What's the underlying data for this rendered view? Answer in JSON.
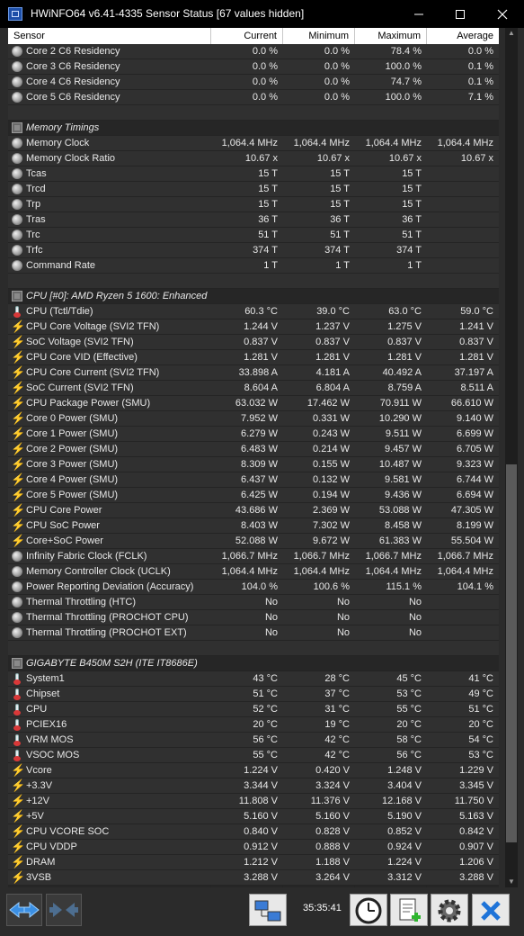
{
  "window": {
    "title": "HWiNFO64 v6.41-4335 Sensor Status [67 values hidden]"
  },
  "columns": [
    "Sensor",
    "Current",
    "Minimum",
    "Maximum",
    "Average"
  ],
  "rows": [
    {
      "type": "sensor",
      "icon": "gear-icon",
      "name": "Core 2 C6 Residency",
      "v": [
        "0.0 %",
        "0.0 %",
        "78.4 %",
        "0.0 %"
      ]
    },
    {
      "type": "sensor",
      "icon": "gear-icon",
      "name": "Core 3 C6 Residency",
      "v": [
        "0.0 %",
        "0.0 %",
        "100.0 %",
        "0.1 %"
      ]
    },
    {
      "type": "sensor",
      "icon": "gear-icon",
      "name": "Core 4 C6 Residency",
      "v": [
        "0.0 %",
        "0.0 %",
        "74.7 %",
        "0.1 %"
      ]
    },
    {
      "type": "sensor",
      "icon": "gear-icon",
      "name": "Core 5 C6 Residency",
      "v": [
        "0.0 %",
        "0.0 %",
        "100.0 %",
        "7.1 %"
      ]
    },
    {
      "type": "blank"
    },
    {
      "type": "group",
      "icon": "chip-icon",
      "name": "Memory Timings"
    },
    {
      "type": "sensor",
      "icon": "gear-icon",
      "name": "Memory Clock",
      "v": [
        "1,064.4 MHz",
        "1,064.4 MHz",
        "1,064.4 MHz",
        "1,064.4 MHz"
      ]
    },
    {
      "type": "sensor",
      "icon": "gear-icon",
      "name": "Memory Clock Ratio",
      "v": [
        "10.67 x",
        "10.67 x",
        "10.67 x",
        "10.67 x"
      ]
    },
    {
      "type": "sensor",
      "icon": "gear-icon",
      "name": "Tcas",
      "v": [
        "15 T",
        "15 T",
        "15 T",
        ""
      ]
    },
    {
      "type": "sensor",
      "icon": "gear-icon",
      "name": "Trcd",
      "v": [
        "15 T",
        "15 T",
        "15 T",
        ""
      ]
    },
    {
      "type": "sensor",
      "icon": "gear-icon",
      "name": "Trp",
      "v": [
        "15 T",
        "15 T",
        "15 T",
        ""
      ]
    },
    {
      "type": "sensor",
      "icon": "gear-icon",
      "name": "Tras",
      "v": [
        "36 T",
        "36 T",
        "36 T",
        ""
      ]
    },
    {
      "type": "sensor",
      "icon": "gear-icon",
      "name": "Trc",
      "v": [
        "51 T",
        "51 T",
        "51 T",
        ""
      ]
    },
    {
      "type": "sensor",
      "icon": "gear-icon",
      "name": "Trfc",
      "v": [
        "374 T",
        "374 T",
        "374 T",
        ""
      ]
    },
    {
      "type": "sensor",
      "icon": "gear-icon",
      "name": "Command Rate",
      "v": [
        "1 T",
        "1 T",
        "1 T",
        ""
      ]
    },
    {
      "type": "blank"
    },
    {
      "type": "group",
      "icon": "chip-icon",
      "name": "CPU [#0]: AMD Ryzen 5 1600: Enhanced"
    },
    {
      "type": "sensor",
      "icon": "thermometer-icon",
      "name": "CPU (Tctl/Tdie)",
      "v": [
        "60.3 °C",
        "39.0 °C",
        "63.0 °C",
        "59.0 °C"
      ]
    },
    {
      "type": "sensor",
      "icon": "bolt-icon",
      "name": "CPU Core Voltage (SVI2 TFN)",
      "v": [
        "1.244 V",
        "1.237 V",
        "1.275 V",
        "1.241 V"
      ]
    },
    {
      "type": "sensor",
      "icon": "bolt-icon",
      "name": "SoC Voltage (SVI2 TFN)",
      "v": [
        "0.837 V",
        "0.837 V",
        "0.837 V",
        "0.837 V"
      ]
    },
    {
      "type": "sensor",
      "icon": "bolt-icon",
      "name": "CPU Core VID (Effective)",
      "v": [
        "1.281 V",
        "1.281 V",
        "1.281 V",
        "1.281 V"
      ]
    },
    {
      "type": "sensor",
      "icon": "bolt-icon",
      "name": "CPU Core Current (SVI2 TFN)",
      "v": [
        "33.898 A",
        "4.181 A",
        "40.492 A",
        "37.197 A"
      ]
    },
    {
      "type": "sensor",
      "icon": "bolt-icon",
      "name": "SoC Current (SVI2 TFN)",
      "v": [
        "8.604 A",
        "6.804 A",
        "8.759 A",
        "8.511 A"
      ]
    },
    {
      "type": "sensor",
      "icon": "bolt-icon",
      "name": "CPU Package Power (SMU)",
      "v": [
        "63.032 W",
        "17.462 W",
        "70.911 W",
        "66.610 W"
      ]
    },
    {
      "type": "sensor",
      "icon": "bolt-icon",
      "name": "Core 0 Power (SMU)",
      "v": [
        "7.952 W",
        "0.331 W",
        "10.290 W",
        "9.140 W"
      ]
    },
    {
      "type": "sensor",
      "icon": "bolt-icon",
      "name": "Core 1 Power (SMU)",
      "v": [
        "6.279 W",
        "0.243 W",
        "9.511 W",
        "6.699 W"
      ]
    },
    {
      "type": "sensor",
      "icon": "bolt-icon",
      "name": "Core 2 Power (SMU)",
      "v": [
        "6.483 W",
        "0.214 W",
        "9.457 W",
        "6.705 W"
      ]
    },
    {
      "type": "sensor",
      "icon": "bolt-icon",
      "name": "Core 3 Power (SMU)",
      "v": [
        "8.309 W",
        "0.155 W",
        "10.487 W",
        "9.323 W"
      ]
    },
    {
      "type": "sensor",
      "icon": "bolt-icon",
      "name": "Core 4 Power (SMU)",
      "v": [
        "6.437 W",
        "0.132 W",
        "9.581 W",
        "6.744 W"
      ]
    },
    {
      "type": "sensor",
      "icon": "bolt-icon",
      "name": "Core 5 Power (SMU)",
      "v": [
        "6.425 W",
        "0.194 W",
        "9.436 W",
        "6.694 W"
      ]
    },
    {
      "type": "sensor",
      "icon": "bolt-icon",
      "name": "CPU Core Power",
      "v": [
        "43.686 W",
        "2.369 W",
        "53.088 W",
        "47.305 W"
      ]
    },
    {
      "type": "sensor",
      "icon": "bolt-icon",
      "name": "CPU SoC Power",
      "v": [
        "8.403 W",
        "7.302 W",
        "8.458 W",
        "8.199 W"
      ]
    },
    {
      "type": "sensor",
      "icon": "bolt-icon",
      "name": "Core+SoC Power",
      "v": [
        "52.088 W",
        "9.672 W",
        "61.383 W",
        "55.504 W"
      ]
    },
    {
      "type": "sensor",
      "icon": "gear-icon",
      "name": "Infinity Fabric Clock (FCLK)",
      "v": [
        "1,066.7 MHz",
        "1,066.7 MHz",
        "1,066.7 MHz",
        "1,066.7 MHz"
      ]
    },
    {
      "type": "sensor",
      "icon": "gear-icon",
      "name": "Memory Controller Clock (UCLK)",
      "v": [
        "1,064.4 MHz",
        "1,064.4 MHz",
        "1,064.4 MHz",
        "1,064.4 MHz"
      ]
    },
    {
      "type": "sensor",
      "icon": "gear-icon",
      "name": "Power Reporting Deviation (Accuracy)",
      "v": [
        "104.0 %",
        "100.6 %",
        "115.1 %",
        "104.1 %"
      ]
    },
    {
      "type": "sensor",
      "icon": "gear-icon",
      "name": "Thermal Throttling (HTC)",
      "v": [
        "No",
        "No",
        "No",
        ""
      ]
    },
    {
      "type": "sensor",
      "icon": "gear-icon",
      "name": "Thermal Throttling (PROCHOT CPU)",
      "v": [
        "No",
        "No",
        "No",
        ""
      ]
    },
    {
      "type": "sensor",
      "icon": "gear-icon",
      "name": "Thermal Throttling (PROCHOT EXT)",
      "v": [
        "No",
        "No",
        "No",
        ""
      ]
    },
    {
      "type": "blank"
    },
    {
      "type": "group",
      "icon": "chip-icon",
      "name": "GIGABYTE B450M S2H (ITE IT8686E)"
    },
    {
      "type": "sensor",
      "icon": "thermometer-icon",
      "name": "System1",
      "v": [
        "43 °C",
        "28 °C",
        "45 °C",
        "41 °C"
      ]
    },
    {
      "type": "sensor",
      "icon": "thermometer-icon",
      "name": "Chipset",
      "v": [
        "51 °C",
        "37 °C",
        "53 °C",
        "49 °C"
      ]
    },
    {
      "type": "sensor",
      "icon": "thermometer-icon",
      "name": "CPU",
      "v": [
        "52 °C",
        "31 °C",
        "55 °C",
        "51 °C"
      ]
    },
    {
      "type": "sensor",
      "icon": "thermometer-icon",
      "name": "PCIEX16",
      "v": [
        "20 °C",
        "19 °C",
        "20 °C",
        "20 °C"
      ]
    },
    {
      "type": "sensor",
      "icon": "thermometer-icon",
      "name": "VRM MOS",
      "v": [
        "56 °C",
        "42 °C",
        "58 °C",
        "54 °C"
      ]
    },
    {
      "type": "sensor",
      "icon": "thermometer-icon",
      "name": "VSOC MOS",
      "v": [
        "55 °C",
        "42 °C",
        "56 °C",
        "53 °C"
      ]
    },
    {
      "type": "sensor",
      "icon": "bolt-icon",
      "name": "Vcore",
      "v": [
        "1.224 V",
        "0.420 V",
        "1.248 V",
        "1.229 V"
      ]
    },
    {
      "type": "sensor",
      "icon": "bolt-icon",
      "name": "+3.3V",
      "v": [
        "3.344 V",
        "3.324 V",
        "3.404 V",
        "3.345 V"
      ]
    },
    {
      "type": "sensor",
      "icon": "bolt-icon",
      "name": "+12V",
      "v": [
        "11.808 V",
        "11.376 V",
        "12.168 V",
        "11.750 V"
      ]
    },
    {
      "type": "sensor",
      "icon": "bolt-icon",
      "name": "+5V",
      "v": [
        "5.160 V",
        "5.160 V",
        "5.190 V",
        "5.163 V"
      ]
    },
    {
      "type": "sensor",
      "icon": "bolt-icon",
      "name": "CPU VCORE SOC",
      "v": [
        "0.840 V",
        "0.828 V",
        "0.852 V",
        "0.842 V"
      ]
    },
    {
      "type": "sensor",
      "icon": "bolt-icon",
      "name": "CPU VDDP",
      "v": [
        "0.912 V",
        "0.888 V",
        "0.924 V",
        "0.907 V"
      ]
    },
    {
      "type": "sensor",
      "icon": "bolt-icon",
      "name": "DRAM",
      "v": [
        "1.212 V",
        "1.188 V",
        "1.224 V",
        "1.206 V"
      ]
    },
    {
      "type": "sensor",
      "icon": "bolt-icon",
      "name": "3VSB",
      "v": [
        "3.288 V",
        "3.264 V",
        "3.312 V",
        "3.288 V"
      ]
    }
  ],
  "toolbar": {
    "time": "35:35:41"
  }
}
